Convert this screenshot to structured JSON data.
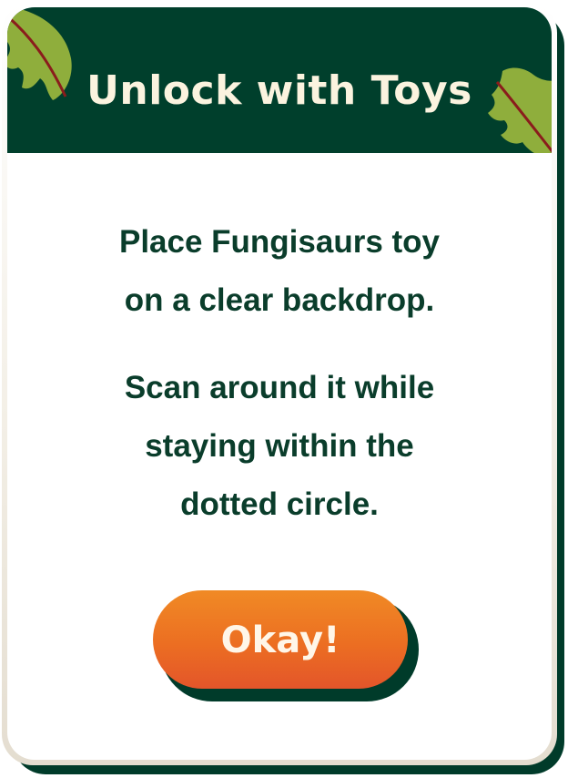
{
  "dialog": {
    "title": "Unlock with Toys",
    "instructions": {
      "paragraph1": [
        "Place Fungisaurs toy",
        "on a clear backdrop."
      ],
      "paragraph2": [
        "Scan around it while",
        "staying within the",
        "dotted circle."
      ]
    },
    "confirm_label": "Okay!"
  },
  "colors": {
    "header_bg": "#003f2c",
    "title_text": "#fbf3df",
    "body_text": "#0a3d2b",
    "button_top": "#f08a25",
    "button_bottom": "#e3552a",
    "shadow": "#003b2a",
    "leaf_green": "#8fae3c",
    "leaf_vein": "#8a1c1c"
  },
  "icons": [
    "leaf-left-icon",
    "leaf-right-icon"
  ]
}
